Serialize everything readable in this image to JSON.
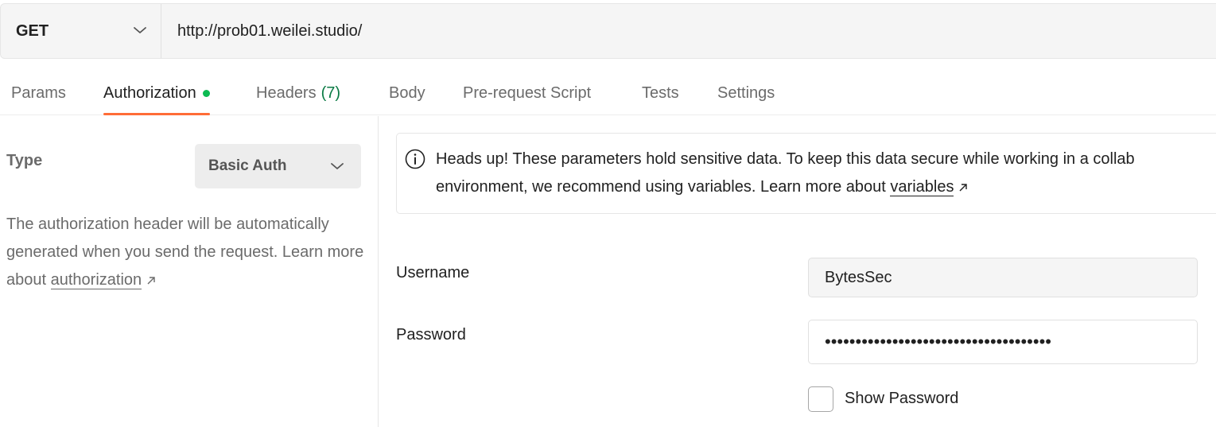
{
  "request": {
    "method": "GET",
    "url": "http://prob01.weilei.studio/"
  },
  "tabs": [
    {
      "label": "Params"
    },
    {
      "label": "Authorization",
      "active": true
    },
    {
      "label": "Headers",
      "count": "(7)"
    },
    {
      "label": "Body"
    },
    {
      "label": "Pre-request Script"
    },
    {
      "label": "Tests"
    },
    {
      "label": "Settings"
    }
  ],
  "auth": {
    "type_label": "Type",
    "type_value": "Basic Auth",
    "desc_prefix": "The authorization header will be automatically generated when you send the request. Learn more about ",
    "desc_link": "authorization"
  },
  "notice": {
    "text_prefix": "Heads up! These parameters hold sensitive data. To keep this data secure while working in a collab",
    "text_line2": "environment, we recommend using variables. Learn more about ",
    "link": "variables"
  },
  "fields": {
    "username_label": "Username",
    "username_value": "BytesSec",
    "password_label": "Password",
    "password_masked": "•••••••••••••••••••••••••••••••••••••",
    "show_password_label": "Show Password"
  },
  "colors": {
    "accent": "#ff6c37",
    "active_dot": "#0cbb52",
    "headers_count": "#0a7a44"
  }
}
